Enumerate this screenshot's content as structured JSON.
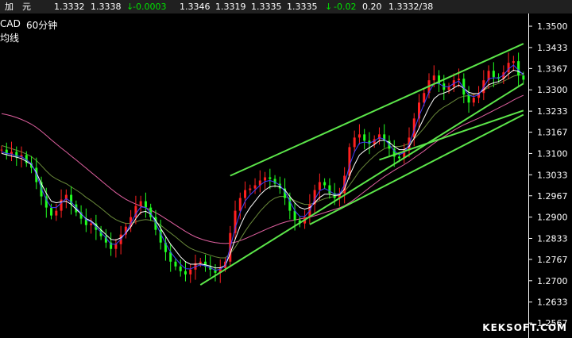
{
  "quote_bar": {
    "name": "加　元",
    "price1": "1.3332",
    "price2": "1.3338",
    "change": "-0.0003",
    "high": "1.3346",
    "low": "1.3319",
    "price3": "1.3335",
    "price4": "1.3335",
    "change_pct": "-0.02",
    "volume": "0.20",
    "last": "1.3332/38",
    "down_arrow": "↓",
    "colors": {
      "text": "#ffffff",
      "down": "#00e000",
      "bar_bg": "#202020"
    }
  },
  "chart_header": {
    "symbol": "CAD",
    "period": "60分钟",
    "subtitle": "均线"
  },
  "watermark": "KEKSOFT.COM",
  "chart_data": {
    "type": "candlestick",
    "y_tick_labels": [
      "1.3500",
      "1.3433",
      "1.3367",
      "1.3300",
      "1.3233",
      "1.3167",
      "1.3100",
      "1.3033",
      "1.2967",
      "1.2900",
      "1.2833",
      "1.2767",
      "1.2700",
      "1.2633",
      "1.2567"
    ],
    "ylim": [
      1.252,
      1.354
    ],
    "grid": false,
    "colors": {
      "up_candle": "#ff2020",
      "down_candle": "#20ff20",
      "ma_white": "#ffffff",
      "ma_blue": "#4040ff",
      "ma_olive": "#6a8a3a",
      "ma_pink": "#e060a0",
      "channel": "#5ce64a"
    },
    "close_series": [
      1.3112,
      1.3098,
      1.3105,
      1.3088,
      1.3095,
      1.307,
      1.3055,
      1.301,
      1.2965,
      1.293,
      1.2905,
      1.292,
      1.2955,
      1.297,
      1.294,
      1.2915,
      1.2895,
      1.2875,
      1.288,
      1.286,
      1.284,
      1.282,
      1.28,
      1.2815,
      1.2845,
      1.287,
      1.29,
      1.2935,
      1.295,
      1.293,
      1.29,
      1.286,
      1.282,
      1.279,
      1.276,
      1.2745,
      1.273,
      1.272,
      1.2735,
      1.2755,
      1.276,
      1.2745,
      1.2735,
      1.2725,
      1.274,
      1.276,
      1.285,
      1.292,
      1.296,
      1.2985,
      1.299,
      1.3,
      1.3015,
      1.3025,
      1.302,
      1.3005,
      1.299,
      1.296,
      1.292,
      1.289,
      1.288,
      1.29,
      1.294,
      1.2985,
      1.301,
      1.3,
      1.2975,
      1.296,
      1.2975,
      1.303,
      1.312,
      1.315,
      1.316,
      1.314,
      1.313,
      1.3145,
      1.316,
      1.314,
      1.3115,
      1.309,
      1.3085,
      1.311,
      1.315,
      1.321,
      1.326,
      1.329,
      1.333,
      1.3345,
      1.332,
      1.33,
      1.331,
      1.333,
      1.3335,
      1.3285,
      1.326,
      1.3275,
      1.329,
      1.333,
      1.336,
      1.334,
      1.3335,
      1.3355,
      1.3385,
      1.339,
      1.3345,
      1.3332
    ],
    "moving_averages": [
      {
        "color": "ma_white",
        "values": [
          1.31,
          1.3096,
          1.3092,
          1.3088,
          1.3084,
          1.3075,
          1.3065,
          1.304,
          1.3005,
          1.2975,
          1.295,
          1.2945,
          1.2948,
          1.295,
          1.294,
          1.2925,
          1.291,
          1.2895,
          1.2888,
          1.2875,
          1.286,
          1.2845,
          1.283,
          1.2828,
          1.2835,
          1.285,
          1.287,
          1.2895,
          1.2915,
          1.2918,
          1.291,
          1.289,
          1.2865,
          1.284,
          1.2815,
          1.2795,
          1.2775,
          1.276,
          1.2752,
          1.2752,
          1.2753,
          1.275,
          1.2746,
          1.274,
          1.2741,
          1.2748,
          1.2785,
          1.283,
          1.2872,
          1.2905,
          1.293,
          1.295,
          1.297,
          1.2985,
          1.2995,
          1.2998,
          1.2995,
          1.2985,
          1.2965,
          1.2945,
          1.293,
          1.2925,
          1.293,
          1.2945,
          1.2962,
          1.2972,
          1.2972,
          1.2968,
          1.297,
          1.2988,
          1.303,
          1.3065,
          1.3095,
          1.3108,
          1.3118,
          1.3128,
          1.314,
          1.3142,
          1.3135,
          1.3122,
          1.3112,
          1.3112,
          1.3122,
          1.3148,
          1.318,
          1.3212,
          1.3245,
          1.3272,
          1.3285,
          1.329,
          1.3296,
          1.3306,
          1.3315,
          1.3305,
          1.3292,
          1.3288,
          1.3288,
          1.33,
          1.3316,
          1.3322,
          1.3326,
          1.3335,
          1.335,
          1.3362,
          1.3358,
          1.335
        ]
      },
      {
        "color": "ma_blue",
        "values": [
          1.3105,
          1.31,
          1.3098,
          1.3092,
          1.309,
          1.308,
          1.3068,
          1.3035,
          1.299,
          1.2955,
          1.293,
          1.293,
          1.2945,
          1.2958,
          1.2948,
          1.293,
          1.2912,
          1.2892,
          1.2885,
          1.287,
          1.2852,
          1.2835,
          1.2815,
          1.2815,
          1.283,
          1.2852,
          1.288,
          1.291,
          1.2932,
          1.293,
          1.2912,
          1.2882,
          1.2848,
          1.2818,
          1.279,
          1.277,
          1.2752,
          1.2738,
          1.2737,
          1.2744,
          1.275,
          1.2747,
          1.2741,
          1.2733,
          1.2736,
          1.2748,
          1.2805,
          1.2865,
          1.2915,
          1.295,
          1.297,
          1.2985,
          1.3,
          1.3012,
          1.3015,
          1.301,
          1.3,
          1.298,
          1.295,
          1.292,
          1.2902,
          1.2902,
          1.292,
          1.2955,
          1.2983,
          1.299,
          1.2982,
          1.2972,
          1.2973,
          1.3002,
          1.3062,
          1.3105,
          1.3132,
          1.3136,
          1.3133,
          1.3139,
          1.315,
          1.3145,
          1.3128,
          1.3108,
          1.3096,
          1.3103,
          1.3128,
          1.3172,
          1.3218,
          1.3255,
          1.3293,
          1.332,
          1.332,
          1.331,
          1.331,
          1.332,
          1.3328,
          1.3306,
          1.3283,
          1.3279,
          1.3285,
          1.3308,
          1.3335,
          1.3338,
          1.3337,
          1.3346,
          1.3366,
          1.3378,
          1.3362,
          1.3347
        ]
      },
      {
        "color": "ma_olive",
        "values": [
          1.3125,
          1.312,
          1.3115,
          1.311,
          1.3105,
          1.3098,
          1.309,
          1.3078,
          1.3062,
          1.3045,
          1.303,
          1.302,
          1.3012,
          1.3005,
          1.2995,
          1.2985,
          1.2975,
          1.2962,
          1.2952,
          1.294,
          1.2928,
          1.2915,
          1.2902,
          1.2892,
          1.2885,
          1.288,
          1.288,
          1.2885,
          1.289,
          1.2892,
          1.289,
          1.2885,
          1.2875,
          1.2862,
          1.285,
          1.2838,
          1.2825,
          1.2812,
          1.2802,
          1.2795,
          1.279,
          1.2785,
          1.278,
          1.2775,
          1.2772,
          1.2772,
          1.2785,
          1.2805,
          1.283,
          1.2855,
          1.2878,
          1.2898,
          1.2918,
          1.2935,
          1.295,
          1.296,
          1.2965,
          1.2965,
          1.296,
          1.2952,
          1.2945,
          1.294,
          1.294,
          1.2945,
          1.2952,
          1.2958,
          1.2962,
          1.2965,
          1.297,
          1.298,
          1.3,
          1.3022,
          1.3045,
          1.3062,
          1.3078,
          1.3092,
          1.3105,
          1.3115,
          1.312,
          1.3122,
          1.3122,
          1.3125,
          1.3132,
          1.3145,
          1.3162,
          1.318,
          1.32,
          1.322,
          1.3235,
          1.3246,
          1.3255,
          1.3265,
          1.3275,
          1.328,
          1.3282,
          1.3285,
          1.329,
          1.3298,
          1.3308,
          1.3315,
          1.332,
          1.3327,
          1.3335,
          1.3343,
          1.3347,
          1.3348
        ]
      },
      {
        "color": "ma_pink",
        "values": [
          1.3225,
          1.3222,
          1.3218,
          1.3213,
          1.3207,
          1.32,
          1.3192,
          1.3182,
          1.317,
          1.3157,
          1.3143,
          1.313,
          1.3117,
          1.3105,
          1.3092,
          1.308,
          1.3067,
          1.3054,
          1.3041,
          1.3028,
          1.3015,
          1.3002,
          1.2989,
          1.2977,
          1.2966,
          1.2956,
          1.2948,
          1.2941,
          1.2935,
          1.2929,
          1.2922,
          1.2914,
          1.2905,
          1.2895,
          1.2885,
          1.2875,
          1.2865,
          1.2855,
          1.2846,
          1.2838,
          1.2832,
          1.2827,
          1.2823,
          1.282,
          1.2818,
          1.2817,
          1.2818,
          1.2821,
          1.2826,
          1.2832,
          1.2839,
          1.2846,
          1.2853,
          1.286,
          1.2867,
          1.2873,
          1.2879,
          1.2884,
          1.2888,
          1.2891,
          1.2894,
          1.2897,
          1.29,
          1.2904,
          1.2909,
          1.2914,
          1.2919,
          1.2924,
          1.2929,
          1.2936,
          1.2945,
          1.2956,
          1.2968,
          1.298,
          1.2992,
          1.3004,
          1.3016,
          1.3027,
          1.3037,
          1.3047,
          1.3056,
          1.3065,
          1.3075,
          1.3086,
          1.3097,
          1.3108,
          1.312,
          1.3132,
          1.3143,
          1.3153,
          1.3163,
          1.3173,
          1.3182,
          1.319,
          1.3197,
          1.3204,
          1.3211,
          1.3219,
          1.3227,
          1.3235,
          1.3243,
          1.3251,
          1.3259,
          1.3268,
          1.3276,
          1.3283
        ]
      }
    ],
    "trendlines": [
      {
        "from": [
          46,
          1.303
        ],
        "to": [
          105,
          1.3445
        ]
      },
      {
        "from": [
          40,
          1.2687
        ],
        "to": [
          105,
          1.332
        ]
      },
      {
        "from": [
          76,
          1.308
        ],
        "to": [
          105,
          1.3235
        ]
      },
      {
        "from": [
          62,
          1.2877
        ],
        "to": [
          105,
          1.3222
        ]
      }
    ]
  }
}
